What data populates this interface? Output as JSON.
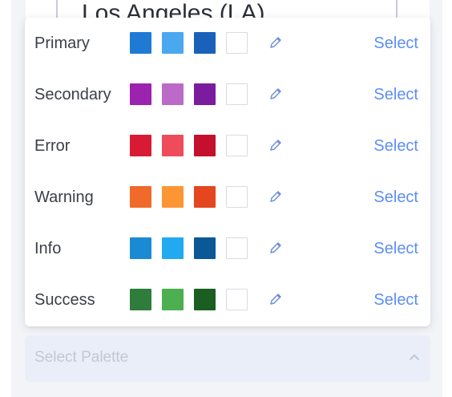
{
  "background": {
    "input_value": "Los Angeles (LA)"
  },
  "palette_list": {
    "select_label": "Select",
    "edit_icon": "pencil-icon",
    "rows": [
      {
        "label": "Primary",
        "colors": [
          "#1f7ad4",
          "#4aa8ee",
          "#1a62b9"
        ]
      },
      {
        "label": "Secondary",
        "colors": [
          "#9c22b0",
          "#bb6ac8",
          "#7b1c9e"
        ]
      },
      {
        "label": "Error",
        "colors": [
          "#d81b35",
          "#ee4c5a",
          "#c4102c"
        ]
      },
      {
        "label": "Warning",
        "colors": [
          "#f06a2a",
          "#fc9634",
          "#e4471f"
        ]
      },
      {
        "label": "Info",
        "colors": [
          "#1a8bd3",
          "#21aaf0",
          "#0b5896"
        ]
      },
      {
        "label": "Success",
        "colors": [
          "#2e7d3a",
          "#4caf50",
          "#1b5e22"
        ]
      }
    ]
  },
  "palette_select": {
    "placeholder": "Select Palette",
    "icon": "chevron-up-icon"
  }
}
